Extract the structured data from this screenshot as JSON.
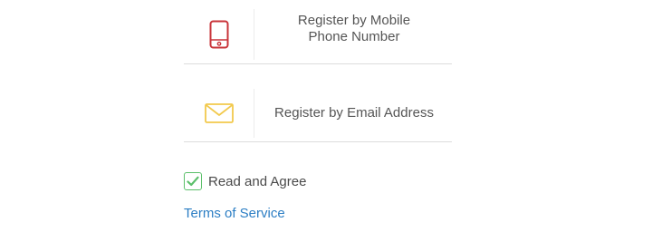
{
  "register_options": [
    {
      "icon": "mobile-phone-icon",
      "icon_color": "#c9343a",
      "label": "Register by Mobile\nPhone Number"
    },
    {
      "icon": "envelope-icon",
      "icon_color": "#f2c94c",
      "label": "Register by Email Address"
    }
  ],
  "agreement": {
    "checked": true,
    "check_color": "#5bbf6a",
    "label": "Read and Agree",
    "terms_link": "Terms of Service",
    "link_color": "#2c7ec4"
  }
}
